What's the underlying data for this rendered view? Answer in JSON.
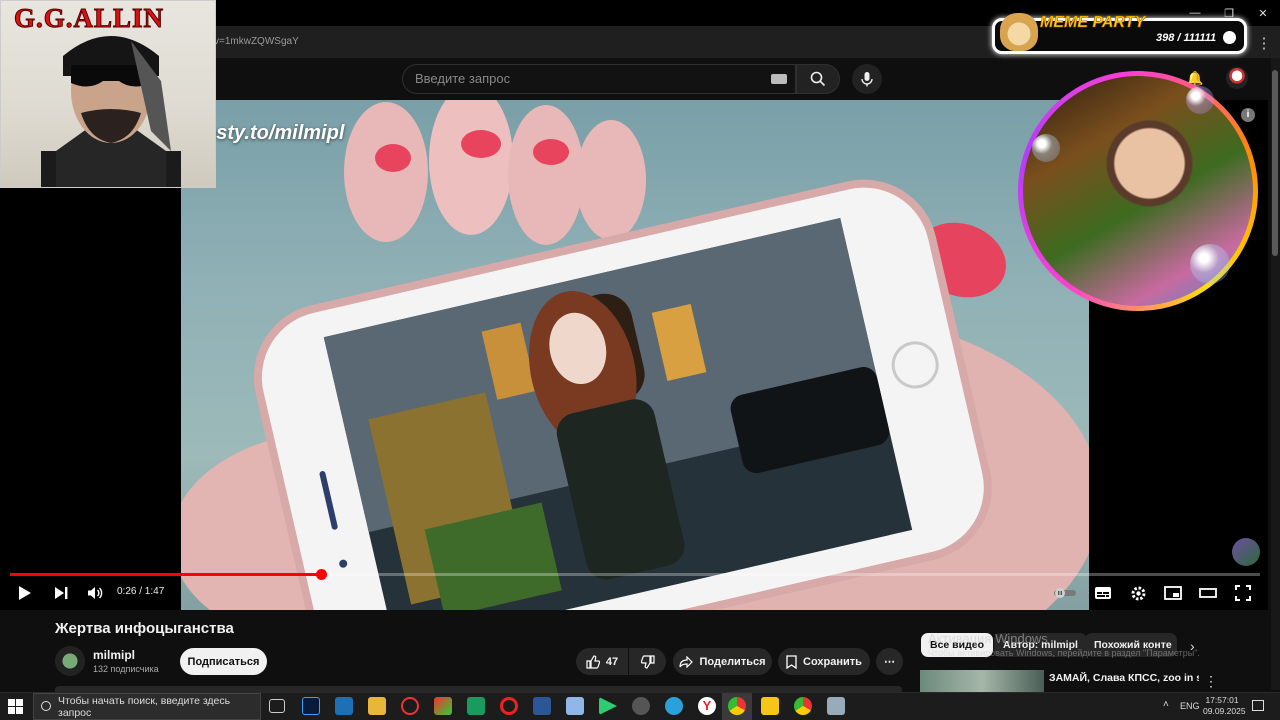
{
  "browser": {
    "url_fragment": "v=1mkwZQWSgaY",
    "window_controls": [
      "—",
      "❐",
      "✕"
    ]
  },
  "header": {
    "search_placeholder": "Введите запрос"
  },
  "video": {
    "watermark": "osty.to/milmipl",
    "current_time": "0:26",
    "duration": "1:47",
    "time_display": "0:26 / 1:47",
    "progress_fraction": 0.249
  },
  "overlay": {
    "gg_title": "G.G.ALLIN",
    "meme_title": "MEME PARTY",
    "meme_count": "398 / 111111"
  },
  "below": {
    "title": "Жертва инфоцыганства",
    "channel_name": "milmipl",
    "subscribers": "132 подписчика",
    "subscribe_label": "Подписаться",
    "like_count": "47",
    "share_label": "Поделиться",
    "save_label": "Сохранить",
    "more_label": "⋯"
  },
  "sidebar": {
    "chips": [
      "Все видео",
      "Автор: milmipl",
      "Похожий конте"
    ],
    "activation_title": "Активация Windows",
    "activation_text": "Чтобы активировать Windows, перейдите в раздел \"Параметры\".",
    "rec_title": "ЗАМАЙ, Слава КПСС, zoo in space - Антихайп (Майти Ди..."
  },
  "taskbar": {
    "search_placeholder": "Чтобы начать поиск, введите здесь запрос",
    "lang": "ENG",
    "time": "17:57:01",
    "date": "09.09.2025"
  },
  "colors": {
    "accent": "#ff0000",
    "background": "#0f0f0f"
  }
}
